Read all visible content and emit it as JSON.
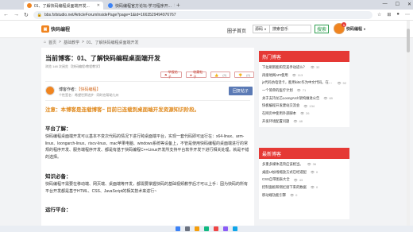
{
  "browser": {
    "tabs": [
      {
        "label": "01、了解快码编程桌面端开发..."
      },
      {
        "label": "快码编程官方论坛-学习程序开..."
      }
    ],
    "url": "bbs.fsfstudio.net/ArticleForumInsidePage?page=1&id=1663529494976767"
  },
  "site": {
    "logo": "快码编程",
    "nav": {
      "forum": "圈子首页",
      "publish": "发帖子"
    },
    "search": {
      "select": "源码",
      "query": "搜索音乐",
      "button": "搜索"
    },
    "user": {
      "name": "快码编程",
      "badge": "1"
    }
  },
  "breadcrumb": [
    "首页",
    "基础教学",
    "01、了解快码编程桌面端开发"
  ],
  "article": {
    "title": "当前博客：01、了解快码编程桌面端开发",
    "meta": "浏览 148 次阅览   【快码编程/教程教学】",
    "actions": [
      {
        "label": "举报帖子"
      },
      {
        "label": "收藏帖子"
      },
      {
        "label": "点赞",
        "count": "(0)"
      },
      {
        "label": "差评",
        "count": "(0)"
      }
    ],
    "author": {
      "prefix": "博客作者：",
      "name": "【快码编程】",
      "sub": "个性签名：希望世界进步 · 同时也帮助九州"
    },
    "reply_button": "回复帖子",
    "notice": "注意：本博客是连载博客~ 目前已连载到桌面端开发资源知识阶段。",
    "sections": [
      {
        "heading": "平台了解：",
        "text": "快码编程桌面端开发可以基本不变次代码的情况下进行跨桌面端平台，实现一套代码即可运行在：x64-linux、arm-linux、loongarch-linux、riscv-linux、mac苹果电脑、windows系统等设备上，不管是使用快码编程的桌面端进行的常规的程序开发、服务端程序开发、都是有基于快码编程C++Linux开发所支持平台软件开发下进行相关处理，就是不错的选择。"
      },
      {
        "heading": "知识必备：",
        "text": "快码编程不需要在移动端、网页端、桌面端等开发，都需要掌握快码的基础视频教学后才可以上手：因为快码的所有平台开发都是基于HTML、CSS、JavaScript的相关技术来进行~"
      }
    ],
    "more_heading": "运行平台："
  },
  "sidebar": {
    "hot": {
      "title": "热门博客",
      "items": [
        {
          "label": "下拉刷新能和完美手动适么？",
          "count": "32"
        },
        {
          "label": "再接地网API使用",
          "count": "113"
        },
        {
          "label": "js代码仿电话卡，能用kittc作为中文代码。在快编出kitty中文注解代码",
          "count": "92"
        },
        {
          "label": "一个简单的医疗计划",
          "count": "71"
        },
        {
          "label": "关于支持龙芯LoongArch架构做进公告",
          "count": "69"
        },
        {
          "label": "快板编程开发建站交流会",
          "count": "134"
        },
        {
          "label": "在网页中使用外部脚本",
          "count": "26"
        },
        {
          "label": "开发环境配置问题",
          "count": "48"
        }
      ]
    },
    "latest": {
      "title": "最新博客",
      "items": [
        {
          "label": "多重多媒体选项应该相当。",
          "count": "36",
          "meta": ""
        },
        {
          "label": "桌面UI加线缩放方式已经适配",
          "count": "0",
          "meta": ""
        },
        {
          "label": "CSS自带图表大全",
          "count": "43",
          "meta": ""
        },
        {
          "label": "控制面板和侧栏接下来的数据",
          "count": "0",
          "meta": ""
        },
        {
          "label": "移动端功能引擎",
          "count": "0",
          "meta": ""
        }
      ]
    }
  },
  "colors": {
    "accent": "#e53935",
    "brand": "#f0841f",
    "notice": "#e08a1e",
    "search": "#2e9e4f"
  }
}
